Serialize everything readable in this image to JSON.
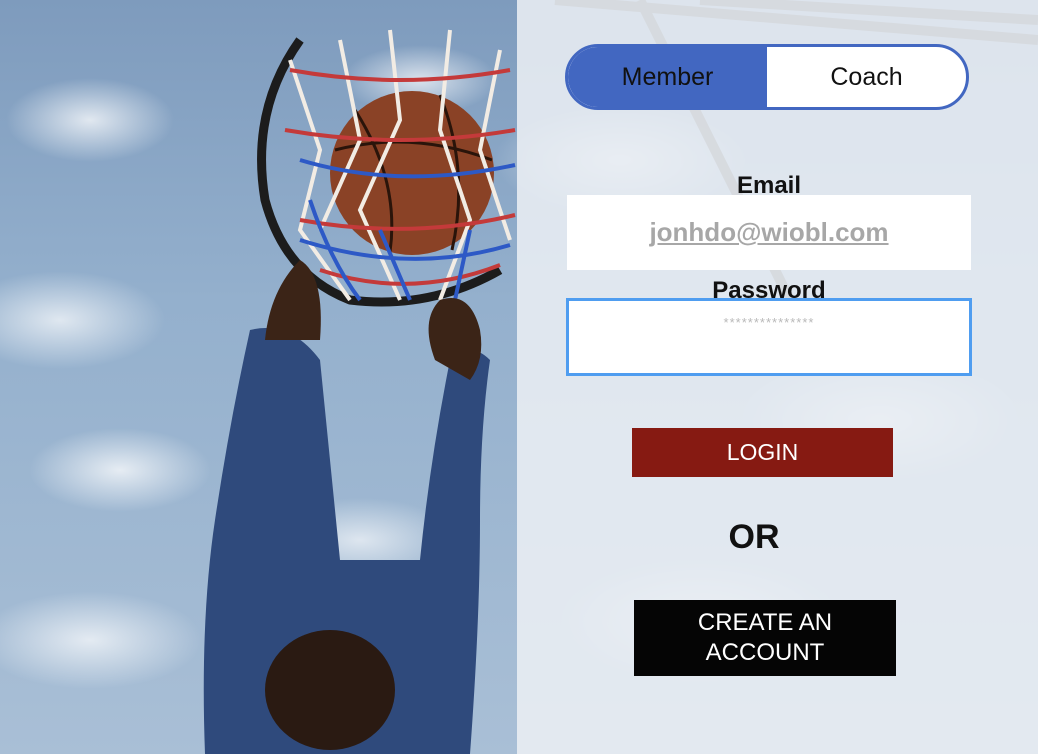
{
  "background": {
    "description_icon": "basketball-dunk-photo"
  },
  "role_toggle": {
    "options": [
      {
        "label": "Member",
        "selected": true
      },
      {
        "label": "Coach",
        "selected": false
      }
    ]
  },
  "form": {
    "email_label": "Email",
    "email_value": "jonhdo@wiobl.com",
    "password_label": "Password",
    "password_mask": "***************"
  },
  "actions": {
    "login_label": "LOGIN",
    "or_label": "OR",
    "create_account_label": "CREATE AN ACCOUNT"
  },
  "colors": {
    "toggle_accent": "#4267c1",
    "password_focus": "#4f9df0",
    "login_bg": "#861a12",
    "create_bg": "#050505"
  }
}
